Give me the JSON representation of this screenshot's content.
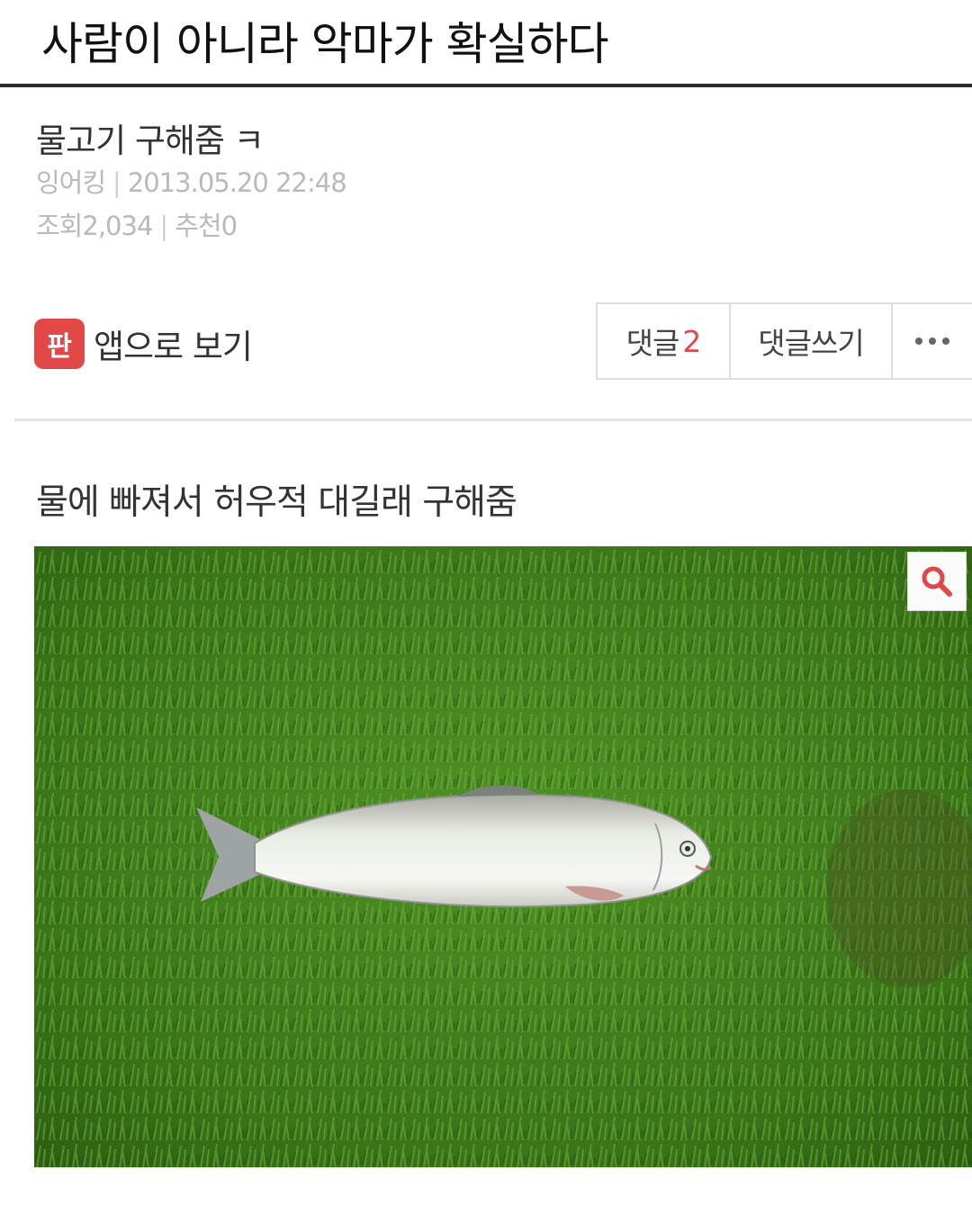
{
  "header": {
    "title": "사람이 아니라 악마가 확실하다"
  },
  "post": {
    "title": "물고기 구해줌 ㅋ",
    "author": "잉어킹",
    "datetime": "2013.05.20 22:48",
    "views_label": "조회",
    "views": "2,034",
    "recommend_label": "추천",
    "recommend": "0",
    "app_icon_glyph": "판",
    "app_view_label": "앱으로 보기",
    "body": "물에 빠져서 허우적 대길래 구해줌"
  },
  "actions": {
    "comments_label": "댓글",
    "comments_count": "2",
    "write_comment_label": "댓글쓰기",
    "more_icon": "ellipsis-icon"
  },
  "colors": {
    "accent": "#e24848",
    "grass": "#3f7a1c",
    "meta_text": "#b9b9b9"
  },
  "photo": {
    "zoom_icon": "magnifier-icon"
  }
}
